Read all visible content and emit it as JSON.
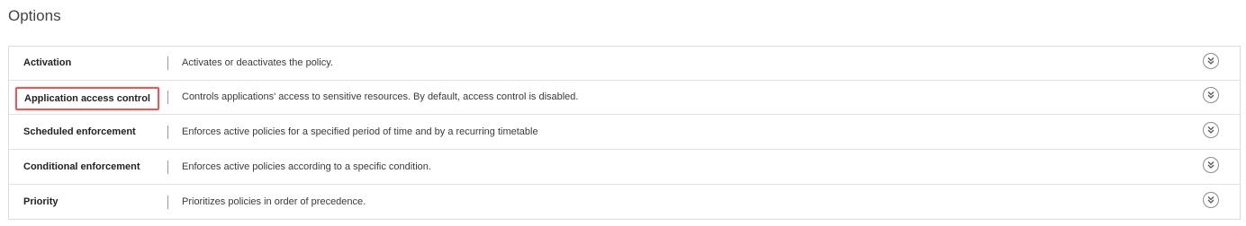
{
  "page": {
    "title": "Options"
  },
  "options": [
    {
      "name": "Activation",
      "description": "Activates or deactivates the policy."
    },
    {
      "name": "Application access control",
      "description": "Controls applications' access to sensitive resources. By default, access control is disabled."
    },
    {
      "name": "Scheduled enforcement",
      "description": "Enforces active policies for a specified period of time and by a recurring timetable"
    },
    {
      "name": "Conditional enforcement",
      "description": "Enforces active policies according to a specific condition."
    },
    {
      "name": "Priority",
      "description": "Prioritizes policies in order of precedence."
    }
  ],
  "icons": {
    "expand": "double-chevron-down-icon"
  },
  "colors": {
    "highlight_border": "#e25a5a",
    "row_border": "#e2e2e2",
    "panel_border": "#dcdcdc"
  }
}
